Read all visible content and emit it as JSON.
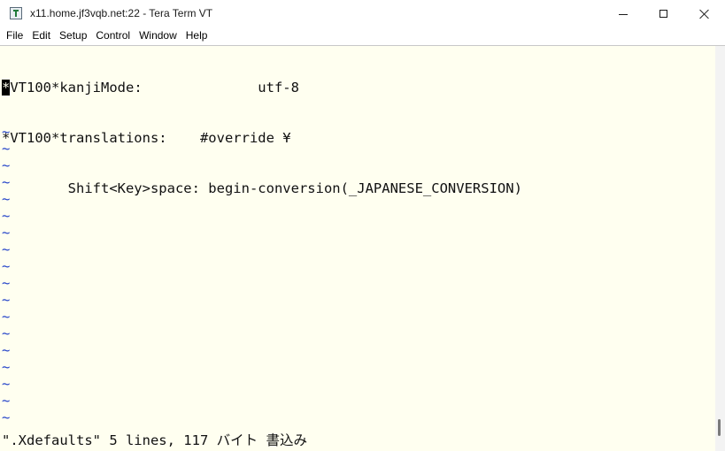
{
  "window": {
    "title": "x11.home.jf3vqb.net:22 - Tera Term VT",
    "icon": "tera-term-icon"
  },
  "menu": {
    "items": [
      "File",
      "Edit",
      "Setup",
      "Control",
      "Window",
      "Help"
    ]
  },
  "terminal": {
    "cursor_char": "*",
    "lines": [
      "VT100*kanjiMode:              utf-8",
      "*VT100*translations:    #override ¥",
      "        Shift<Key>space: begin-conversion(_JAPANESE_CONVERSION)"
    ],
    "empty_line_marker": "~",
    "empty_line_count": 18,
    "status": "\".Xdefaults\" 5 lines, 117 バイト 書込み"
  },
  "colors": {
    "terminal_bg": "#fffff0",
    "terminal_fg": "#111111",
    "tilde": "#1f3fc8"
  }
}
